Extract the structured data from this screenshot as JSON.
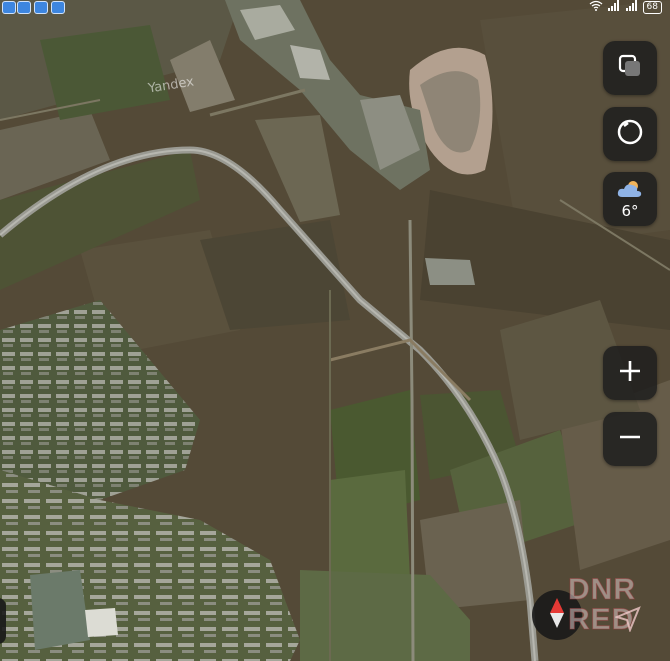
{
  "map": {
    "type": "satellite",
    "provider_label": "Yandex",
    "colors": {
      "field_dark": "#4d4434",
      "field_mid": "#5f5540",
      "grass": "#4a5230",
      "road": "#9a9a92",
      "urban": "#7c7e74",
      "quarry": "#b59e8d"
    }
  },
  "status_bar": {
    "app_icons": [
      "gallery-icon",
      "messenger-icon",
      "image-icon",
      "cloud-icon"
    ],
    "right_icons": [
      "wifi-icon",
      "signal-icon",
      "signal-icon"
    ],
    "battery_level": "68"
  },
  "controls": {
    "layers_icon": "layers-icon",
    "route_icon": "circle-icon",
    "weather": {
      "icon": "cloud-icon",
      "temperature": "6°"
    },
    "zoom_in_label": "+",
    "zoom_out_label": "−",
    "compass_icon": "compass-icon",
    "locate_icon": "navigation-arrow-icon"
  },
  "watermark": {
    "line1": "DNR",
    "line2": "RED"
  }
}
